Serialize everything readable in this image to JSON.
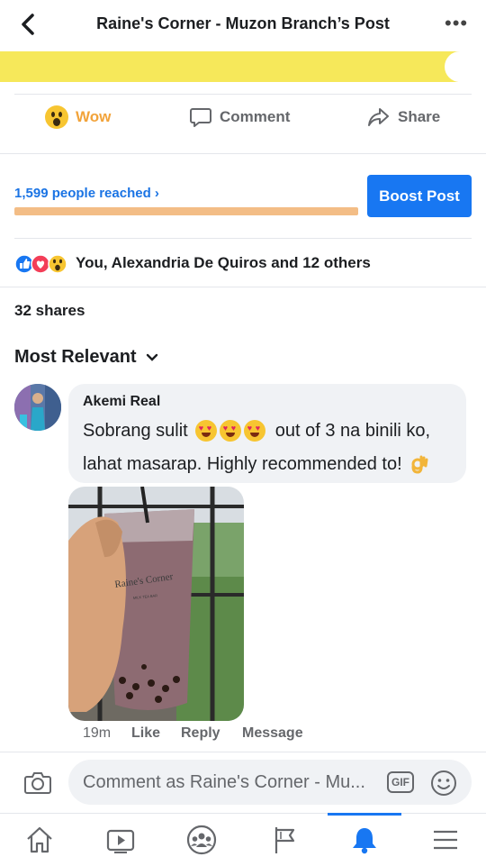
{
  "header": {
    "title": "Raine's Corner - Muzon Branch’s Post",
    "back_icon": "back-arrow-icon",
    "more_icon": "more-icon"
  },
  "actions": {
    "wow_label": "Wow",
    "comment_label": "Comment",
    "share_label": "Share"
  },
  "insights": {
    "reach_text": "1,599 people reached",
    "boost_label": "Boost Post"
  },
  "reactions": {
    "summary": "You, Alexandria De Quiros and 12 others",
    "shares": "32 shares"
  },
  "sort": {
    "label": "Most Relevant"
  },
  "comment": {
    "author": "Akemi Real",
    "text_part1": "Sobrang sulit",
    "text_part2": "out of 3 na binili ko,",
    "text_line2": "lahat masarap. Highly recommended to!",
    "image_text": "Raine's Corner",
    "image_subtext": "MILK TEA BAR",
    "time": "19m",
    "like_label": "Like",
    "reply_label": "Reply",
    "message_label": "Message"
  },
  "composer": {
    "placeholder": "Comment as Raine's Corner - Mu...",
    "gif_label": "GIF"
  },
  "colors": {
    "accent": "#1877f2",
    "wow": "#f2a33a",
    "banner_yellow": "#f6e85a",
    "reach_bar": "#f3bd86"
  },
  "nav": {
    "items": [
      "home-icon",
      "watch-icon",
      "groups-icon",
      "pages-flag-icon",
      "notifications-bell-icon",
      "menu-icon"
    ],
    "active": "notifications-bell-icon"
  }
}
